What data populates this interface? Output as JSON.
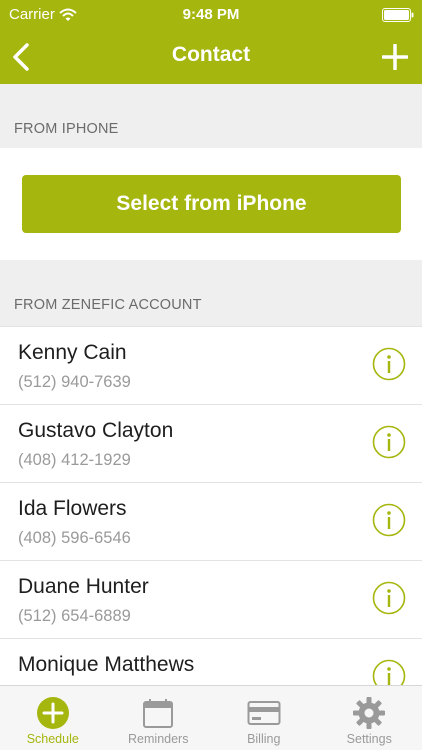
{
  "status_bar": {
    "carrier": "Carrier",
    "time": "9:48 PM"
  },
  "nav": {
    "title": "Contact",
    "back_icon": "chevron-left-icon",
    "add_icon": "plus-icon"
  },
  "sections": {
    "iphone": {
      "header": "FROM IPHONE",
      "button_label": "Select from iPhone"
    },
    "account": {
      "header": "FROM ZENEFIC ACCOUNT"
    }
  },
  "contacts": [
    {
      "name": "Kenny Cain",
      "phone": "(512) 940-7639"
    },
    {
      "name": "Gustavo Clayton",
      "phone": "(408) 412-1929"
    },
    {
      "name": "Ida Flowers",
      "phone": "(408) 596-6546"
    },
    {
      "name": "Duane Hunter",
      "phone": "(512) 654-6889"
    },
    {
      "name": "Monique Matthews",
      "phone": ""
    }
  ],
  "tabs": [
    {
      "label": "Schedule",
      "icon": "plus-circle-icon",
      "active": true
    },
    {
      "label": "Reminders",
      "icon": "calendar-icon",
      "active": false
    },
    {
      "label": "Billing",
      "icon": "credit-card-icon",
      "active": false
    },
    {
      "label": "Settings",
      "icon": "gear-icon",
      "active": false
    }
  ],
  "colors": {
    "accent": "#a5b60e",
    "section_bg": "#efefef",
    "tab_inactive": "#9a9a9a"
  }
}
